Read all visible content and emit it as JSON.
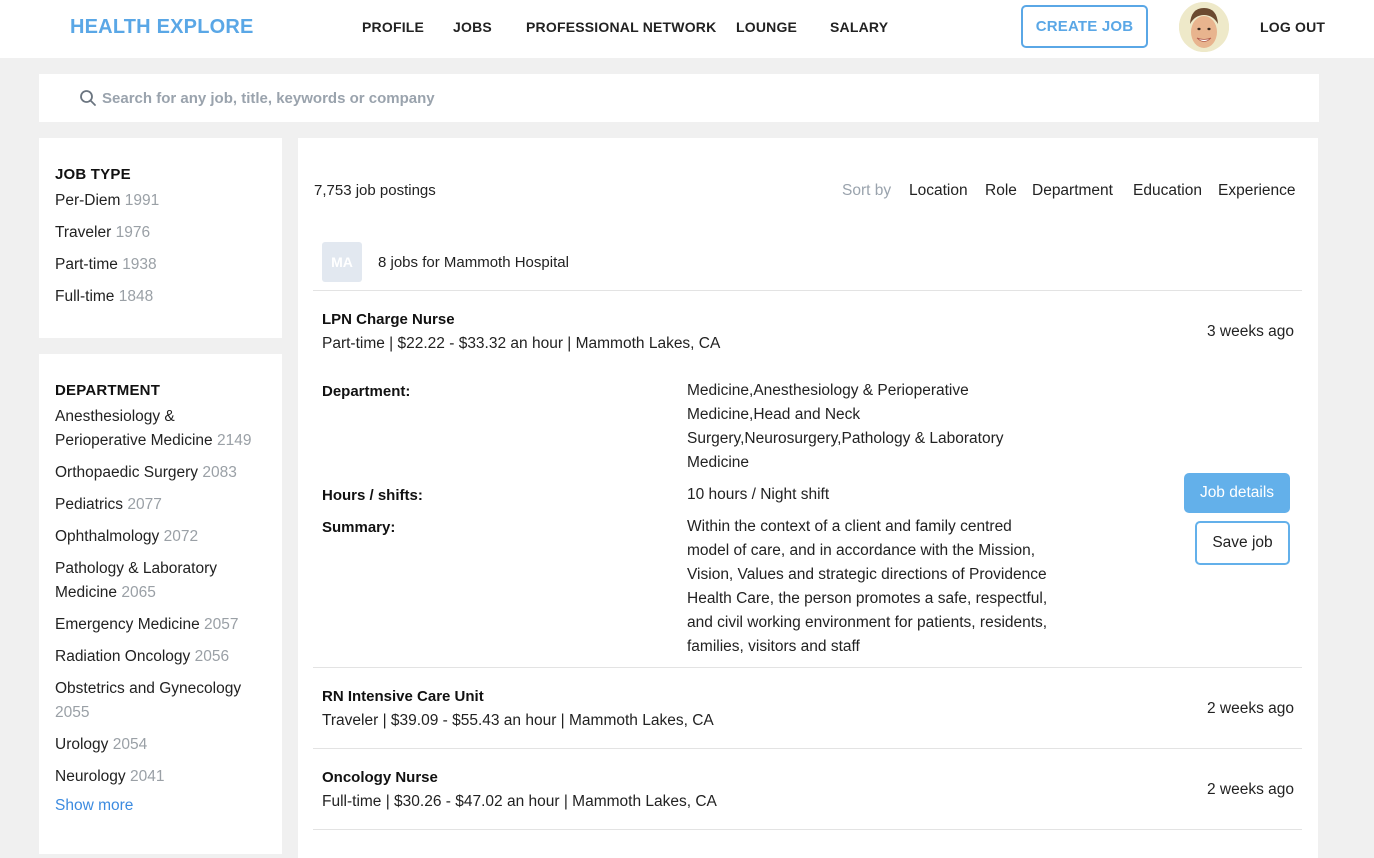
{
  "header": {
    "brand": "HEALTH EXPLORE",
    "nav": [
      "PROFILE",
      "JOBS",
      "PROFESSIONAL NETWORK",
      "LOUNGE",
      "SALARY"
    ],
    "create_job": "CREATE JOB",
    "logout": "LOG OUT",
    "avatar_icon": "user-avatar"
  },
  "search": {
    "placeholder": "Search for any job, title, keywords or company",
    "icon": "search-icon"
  },
  "filters": {
    "job_type": {
      "title": "JOB TYPE",
      "items": [
        {
          "label": "Per-Diem",
          "count": "1991"
        },
        {
          "label": "Traveler",
          "count": "1976"
        },
        {
          "label": "Part-time",
          "count": "1938"
        },
        {
          "label": "Full-time",
          "count": "1848"
        }
      ]
    },
    "department": {
      "title": "DEPARTMENT",
      "items": [
        {
          "label": "Anesthesiology & Perioperative Medicine",
          "count": "2149"
        },
        {
          "label": "Orthopaedic Surgery",
          "count": "2083"
        },
        {
          "label": "Pediatrics",
          "count": "2077"
        },
        {
          "label": "Ophthalmology",
          "count": "2072"
        },
        {
          "label": "Pathology & Laboratory Medicine",
          "count": "2065"
        },
        {
          "label": "Emergency Medicine",
          "count": "2057"
        },
        {
          "label": "Radiation Oncology",
          "count": "2056"
        },
        {
          "label": "Obstetrics and Gynecology",
          "count": "2055"
        },
        {
          "label": "Urology",
          "count": "2054"
        },
        {
          "label": "Neurology",
          "count": "2041"
        }
      ],
      "show_more": "Show more"
    }
  },
  "results": {
    "count_text": "7,753 job postings",
    "sort_label": "Sort by",
    "sort_options": [
      "Location",
      "Role",
      "Department",
      "Education",
      "Experience"
    ],
    "employer": {
      "initials": "MA",
      "text": "8 jobs for Mammoth Hospital"
    },
    "jobs": [
      {
        "title": "LPN Charge Nurse",
        "subtitle": "Part-time | $22.22 - $33.32 an hour | Mammoth Lakes, CA",
        "age": "3 weeks ago",
        "department_label": "Department:",
        "department_value": "Medicine,Anesthesiology & Perioperative Medicine,Head and Neck Surgery,Neurosurgery,Pathology & Laboratory Medicine",
        "hours_label": "Hours / shifts:",
        "hours_value": "10 hours / Night shift",
        "summary_label": "Summary:",
        "summary_value": "Within the context of a client and family centred model of care, and in accordance with the Mission, Vision, Values and strategic directions of Providence Health Care, the person promotes a safe, respectful, and civil working environment for patients, residents, families, visitors and staff",
        "details_button": "Job details",
        "save_button": "Save job"
      },
      {
        "title": "RN Intensive Care Unit",
        "subtitle": "Traveler | $39.09 - $55.43 an hour | Mammoth Lakes, CA",
        "age": "2 weeks ago"
      },
      {
        "title": "Oncology Nurse",
        "subtitle": "Full-time | $30.26 - $47.02 an hour | Mammoth Lakes, CA",
        "age": "2 weeks ago"
      }
    ]
  }
}
